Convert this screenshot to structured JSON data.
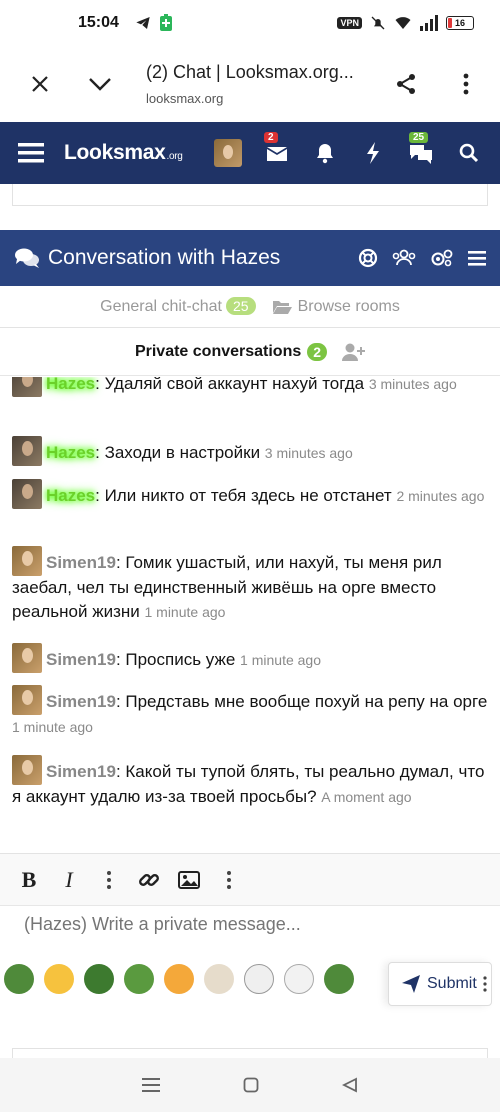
{
  "status_bar": {
    "time": "15:04",
    "vpn_label": "VPN",
    "battery": "16"
  },
  "browser": {
    "page_title": "(2) Chat | Looksmax.org...",
    "url": "looksmax.org"
  },
  "site_nav": {
    "logo": "Looksmax",
    "logo_suffix": ".org",
    "inbox_badge": "2",
    "chat_badge": "25"
  },
  "conversation": {
    "title": "Conversation with Hazes"
  },
  "rooms": {
    "general_label": "General chit-chat",
    "general_count": "25",
    "browse_label": "Browse rooms",
    "private_label": "Private conversations",
    "private_count": "2"
  },
  "messages": [
    {
      "author": "Hazes",
      "text": ": Удаляй свой аккаунт нахуй тогда ",
      "time": "3 minutes ago"
    },
    {
      "author": "Hazes",
      "text": ": Заходи в настройки ",
      "time": "3 minutes ago"
    },
    {
      "author": "Hazes",
      "text": ": Или никто от тебя здесь не отстанет ",
      "time": "2 minutes ago"
    },
    {
      "author": "Simen19",
      "text": ": Гомик ушастый, или нахуй, ты меня рил заебал, чел ты единственный живёшь на орге вместо реальной жизни ",
      "time": "1 minute ago"
    },
    {
      "author": "Simen19",
      "text": ": Проспись уже ",
      "time": "1 minute ago"
    },
    {
      "author": "Simen19",
      "text": ": Представь мне вообще похуй на репу на орге ",
      "time": "1 minute ago"
    },
    {
      "author": "Simen19",
      "text": ": Какой ты тупой блять, ты реально думал, что я аккаунт удалю из-за твоей просьбы? ",
      "time": "A moment ago"
    }
  ],
  "editor": {
    "bold_label": "B",
    "italic_label": "I",
    "placeholder": "(Hazes) Write a private message...",
    "submit_label": "Submit"
  },
  "colors": {
    "nav_bg": "#1f3366",
    "header_bg": "#2a4480",
    "hazes_name": "#6bd12a",
    "badge_green": "#7cc442",
    "badge_red": "#d33333"
  }
}
